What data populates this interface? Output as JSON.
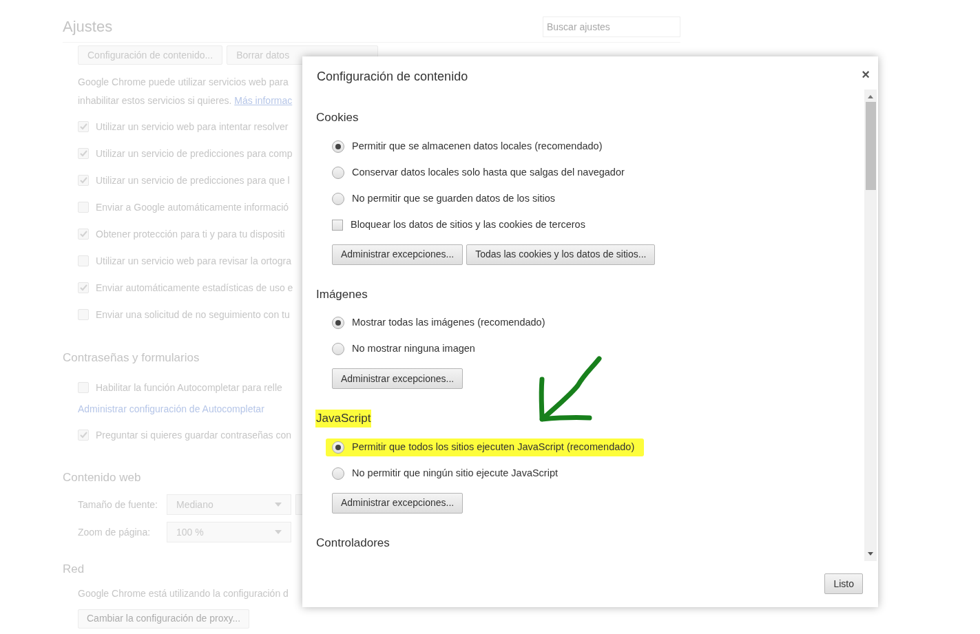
{
  "page": {
    "title": "Ajustes",
    "search": {
      "placeholder": "Buscar ajustes"
    },
    "top_buttons": [
      "Configuración de contenido...",
      "Borrar datos"
    ],
    "intro": {
      "text": "Google Chrome puede utilizar servicios web para",
      "text2": "inhabilitar estos servicios si quieres.",
      "link": "Más informac"
    },
    "privacy_options": [
      {
        "label": "Utilizar un servicio web para intentar resolver",
        "checked": true
      },
      {
        "label": "Utilizar un servicio de predicciones para comp",
        "checked": true
      },
      {
        "label": "Utilizar un servicio de predicciones para que l",
        "checked": true
      },
      {
        "label": "Enviar a Google automáticamente informació",
        "checked": false
      },
      {
        "label": "Obtener protección para ti y para tu dispositi",
        "checked": true
      },
      {
        "label": "Utilizar un servicio web para revisar la ortogra",
        "checked": false
      },
      {
        "label": "Enviar automáticamente estadísticas de uso e",
        "checked": true
      },
      {
        "label": "Enviar una solicitud de no seguimiento con tu",
        "checked": false
      }
    ],
    "passwords": {
      "title": "Contraseñas y formularios",
      "autofill": {
        "label": "Habilitar la función Autocompletar para relle",
        "checked": false
      },
      "autofill_link": "Administrar configuración de Autocompletar",
      "save_passwords": {
        "label": "Preguntar si quieres guardar contraseñas con",
        "checked": true
      }
    },
    "web_content": {
      "title": "Contenido web",
      "font_size": {
        "label": "Tamaño de fuente:",
        "value": "Mediano"
      },
      "zoom": {
        "label": "Zoom de página:",
        "value": "100 %"
      }
    },
    "network": {
      "title": "Red",
      "text": "Google Chrome está utilizando la configuración d",
      "button": "Cambiar la configuración de proxy..."
    }
  },
  "dialog": {
    "title": "Configuración de contenido",
    "close": "×",
    "sections": [
      {
        "title": "Cookies",
        "highlighted": false,
        "items": [
          {
            "kind": "radio",
            "label": "Permitir que se almacenen datos locales (recomendado)",
            "selected": true,
            "highlighted": false
          },
          {
            "kind": "radio",
            "label": "Conservar datos locales solo hasta que salgas del navegador",
            "selected": false,
            "highlighted": false
          },
          {
            "kind": "radio",
            "label": "No permitir que se guarden datos de los sitios",
            "selected": false,
            "highlighted": false
          },
          {
            "kind": "checkbox",
            "label": "Bloquear los datos de sitios y las cookies de terceros",
            "checked": false,
            "highlighted": false
          }
        ],
        "buttons": [
          "Administrar excepciones...",
          "Todas las cookies y los datos de sitios..."
        ]
      },
      {
        "title": "Imágenes",
        "highlighted": false,
        "items": [
          {
            "kind": "radio",
            "label": "Mostrar todas las imágenes (recomendado)",
            "selected": true,
            "highlighted": false
          },
          {
            "kind": "radio",
            "label": "No mostrar ninguna imagen",
            "selected": false,
            "highlighted": false
          }
        ],
        "buttons": [
          "Administrar excepciones..."
        ]
      },
      {
        "title": "JavaScript",
        "highlighted": true,
        "items": [
          {
            "kind": "radio",
            "label": "Permitir que todos los sitios ejecuten JavaScript (recomendado)",
            "selected": true,
            "highlighted": true
          },
          {
            "kind": "radio",
            "label": "No permitir que ningún sitio ejecute JavaScript",
            "selected": false,
            "highlighted": false
          }
        ],
        "buttons": [
          "Administrar excepciones..."
        ]
      },
      {
        "title": "Controladores",
        "highlighted": false
      }
    ],
    "done_button": "Listo"
  }
}
